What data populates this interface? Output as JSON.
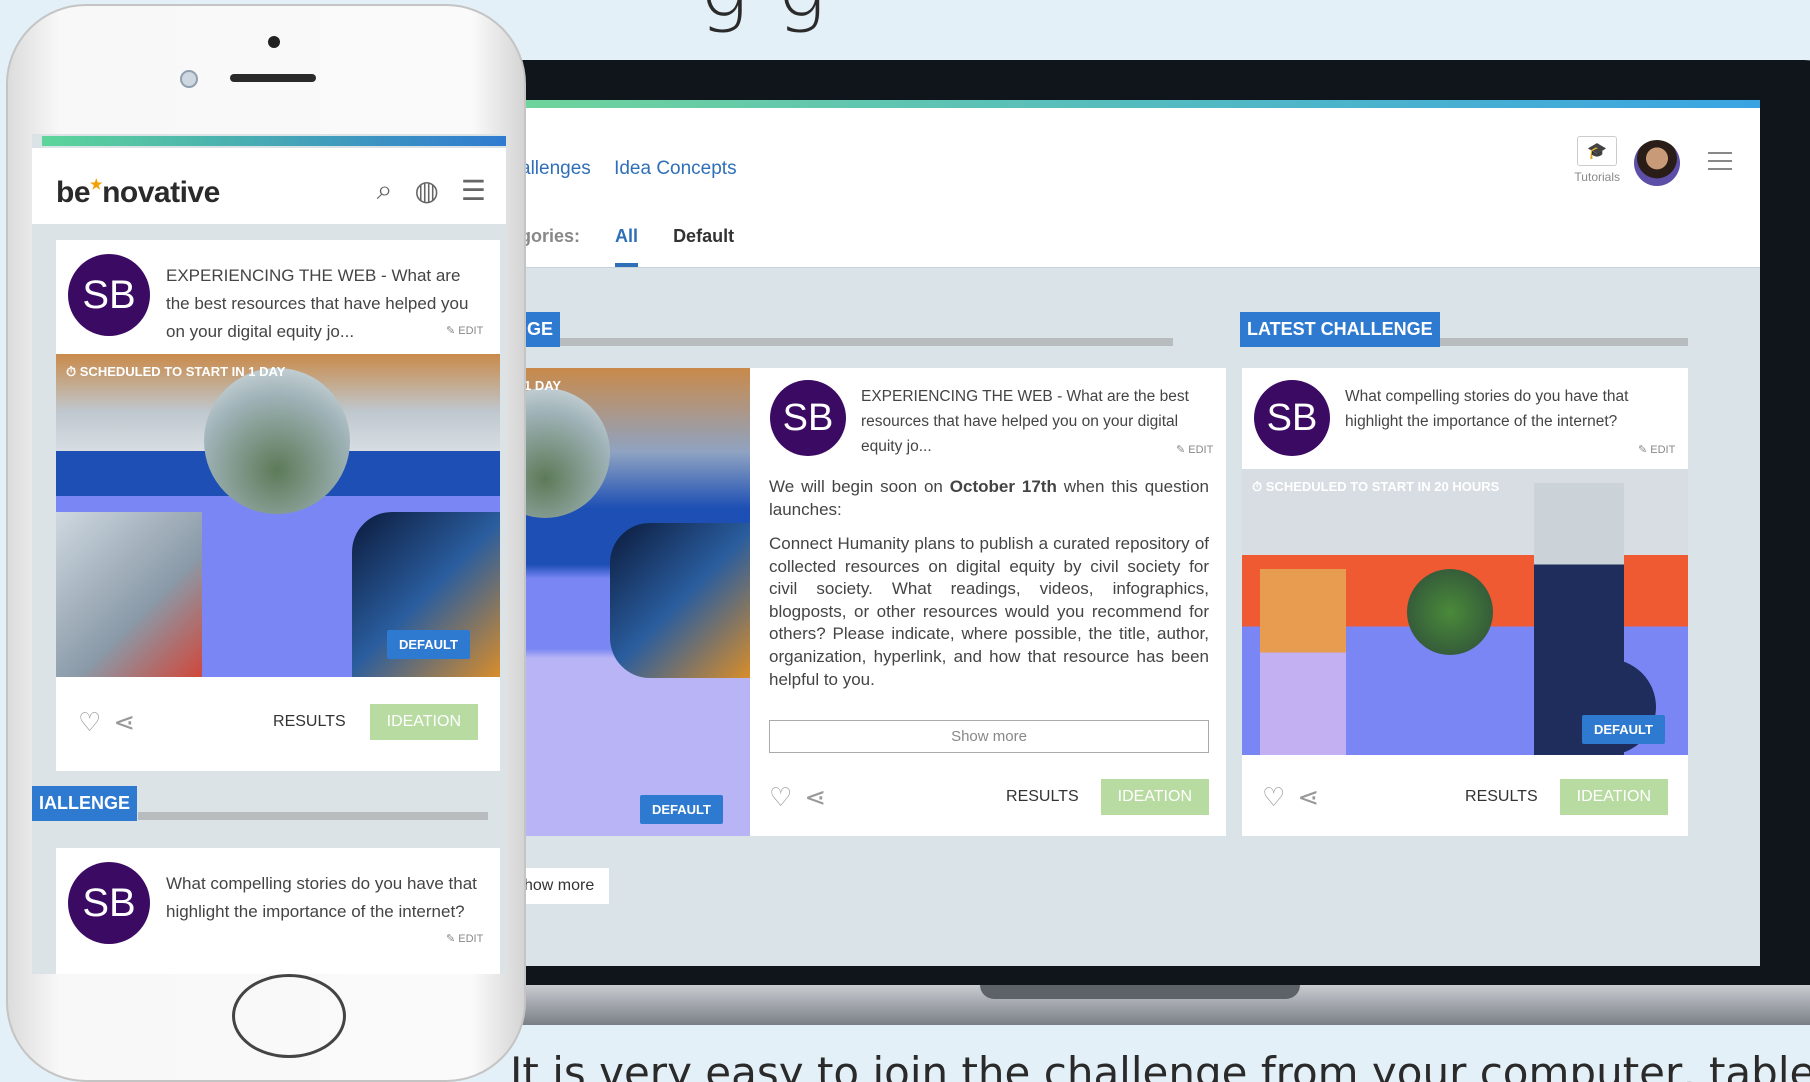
{
  "top_heading": "g                        g",
  "bottom_caption": "It is very easy to join the challenge from your computer, tablet",
  "laptop": {
    "nav": [
      "allenges",
      "Idea Concepts"
    ],
    "categories_label": "gories:",
    "categories": [
      "All",
      "Default"
    ],
    "tutorials_label": "Tutorials",
    "left_section_label": "GE",
    "right_section_label": "LATEST CHALLENGE",
    "main_card": {
      "initials": "SB",
      "title": "EXPERIENCING THE WEB - What are the best resources that have helped you on your digital equity jo...",
      "edit": "EDIT",
      "sched_partial": "1 DAY",
      "para1_a": "We will begin soon on ",
      "para1_b": "October 17th",
      "para1_c": " when this question launches:",
      "para2": "Connect Humanity plans to publish a curated repository of collected resources on digital equity by civil society for civil society. What readings, videos, infographics, blogposts, or other resources would you recommend for others? Please indicate, where possible, the title, author, organization, hyperlink, and how that resource has been helpful to you.",
      "show_more": "Show more",
      "results": "RESULTS",
      "ideation": "IDEATION",
      "default": "DEFAULT"
    },
    "side_card": {
      "initials": "SB",
      "title": "What compelling stories do you have that highlight the importance of the internet?",
      "edit": "EDIT",
      "sched": "SCHEDULED TO START IN 20 HOURS",
      "default": "DEFAULT",
      "results": "RESULTS",
      "ideation": "IDEATION"
    },
    "show_more_bottom": "how more"
  },
  "phone": {
    "logo_a": "be",
    "logo_b": "novative",
    "card1": {
      "initials": "SB",
      "title": "EXPERIENCING THE WEB - What are the best resources that have helped you on your digital equity jo...",
      "edit": "EDIT",
      "sched": "SCHEDULED TO START IN 1 DAY",
      "default": "DEFAULT",
      "results": "RESULTS",
      "ideation": "IDEATION"
    },
    "section_label": "IALLENGE",
    "card2": {
      "initials": "SB",
      "title": "What compelling stories do you have that highlight the importance of the internet?",
      "edit": "EDIT"
    }
  },
  "colors": {
    "brand_blue": "#2f7ad1",
    "avatar_purple": "#3b0a63",
    "ideation_green": "#b8dba1"
  }
}
